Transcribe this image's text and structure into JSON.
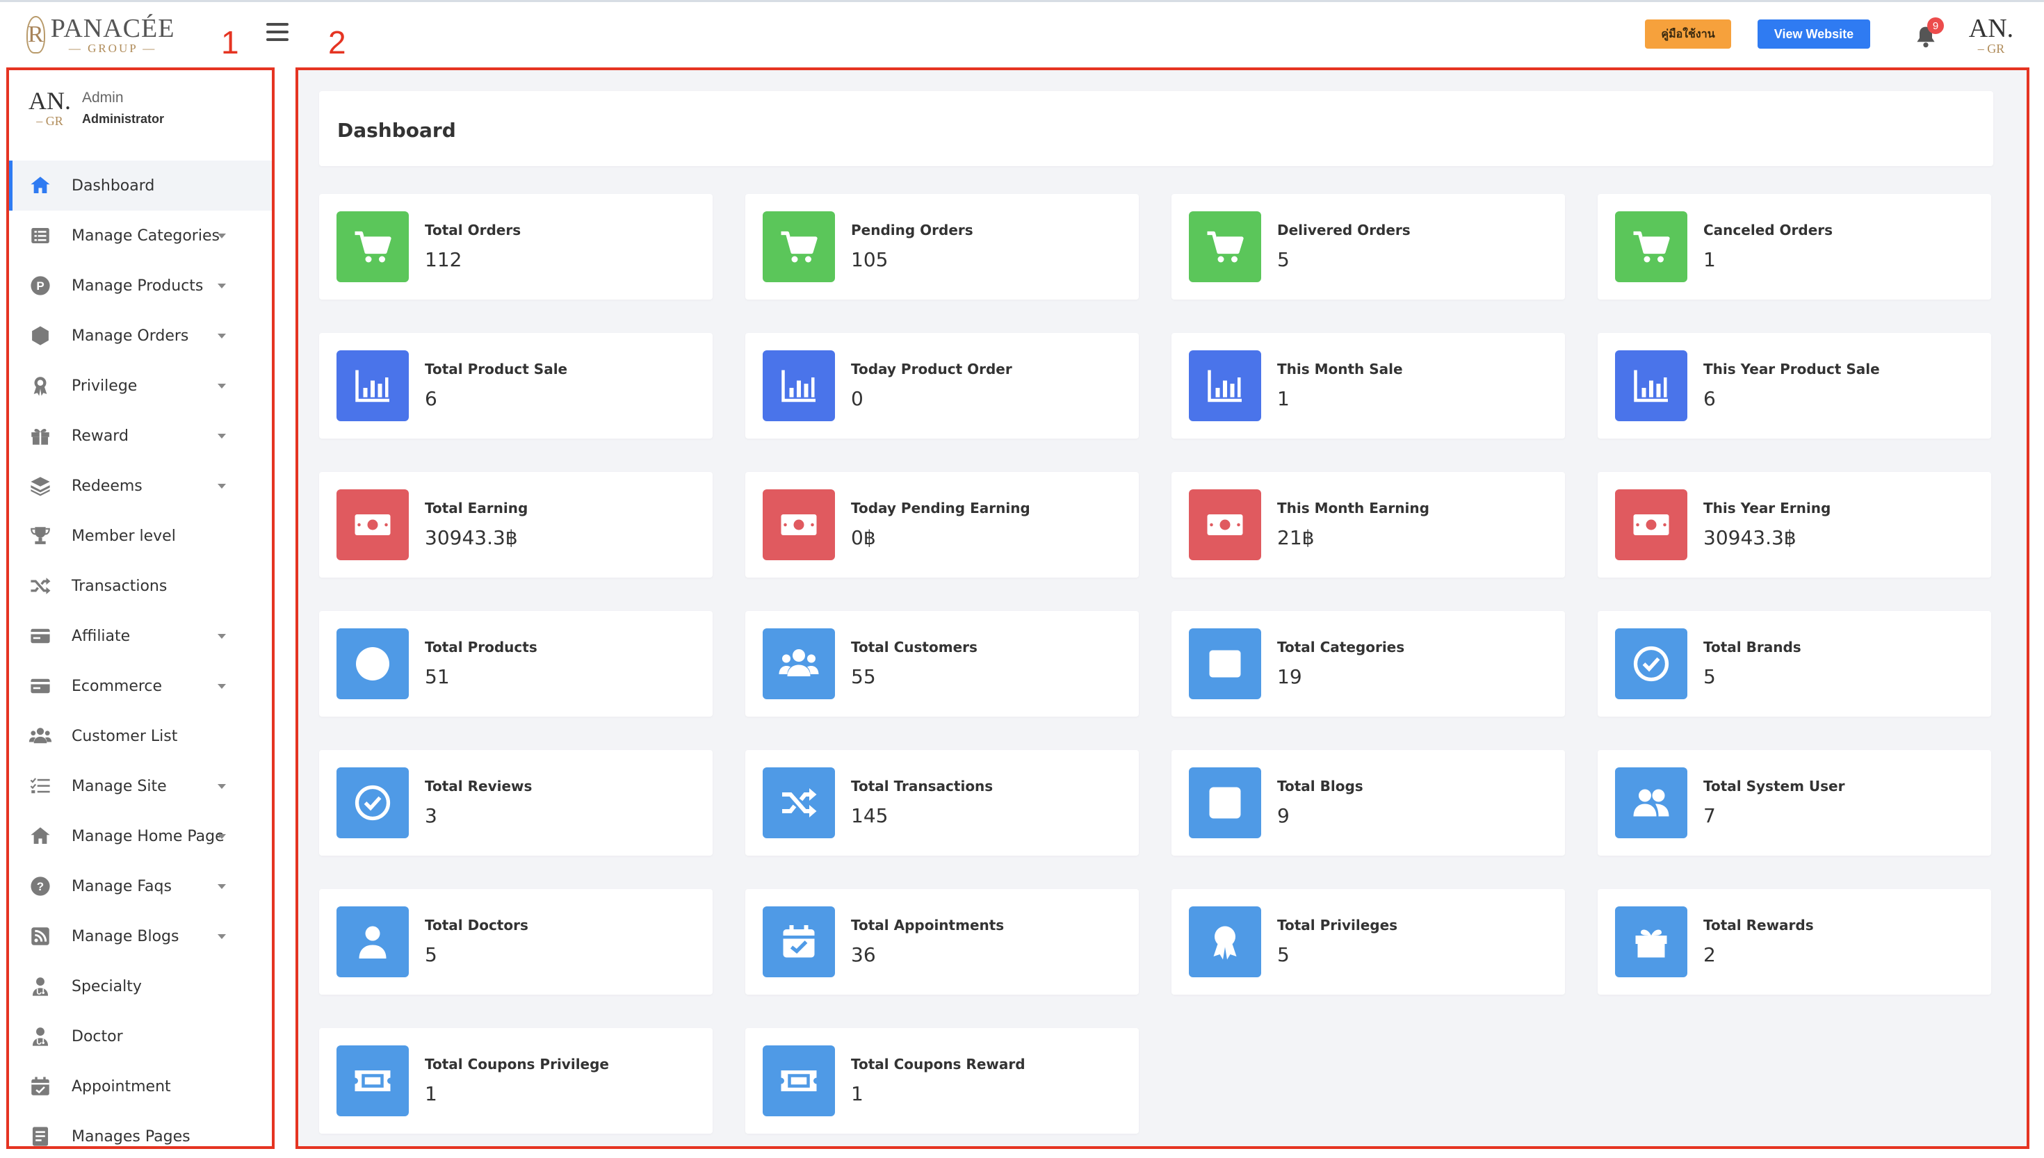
{
  "brand": {
    "mark": "R",
    "name": "PANACÉE",
    "sub": "— GROUP —"
  },
  "annotations": {
    "sidebar": "1",
    "content": "2"
  },
  "topbar": {
    "manual_button": "คู่มือใช้งาน",
    "view_website_button": "View Website",
    "notification_count": "9",
    "avatar_text": "AN.",
    "avatar_sub": "– GR"
  },
  "user": {
    "avatar_text": "AN.",
    "avatar_sub": "– GR",
    "role": "Admin",
    "name": "Administrator"
  },
  "sidebar": {
    "accent": "#2f7bf2",
    "items": [
      {
        "label": "Dashboard",
        "icon": "home-icon",
        "caret": false,
        "active": true
      },
      {
        "label": "Manage Categories",
        "icon": "list-icon",
        "caret": true
      },
      {
        "label": "Manage Products",
        "icon": "p-circle-icon",
        "caret": true
      },
      {
        "label": "Manage Orders",
        "icon": "box-icon",
        "caret": true
      },
      {
        "label": "Privilege",
        "icon": "award-icon",
        "caret": true
      },
      {
        "label": "Reward",
        "icon": "gift-icon",
        "caret": true
      },
      {
        "label": "Redeems",
        "icon": "layers-icon",
        "caret": true
      },
      {
        "label": "Member level",
        "icon": "trophy-icon",
        "caret": false
      },
      {
        "label": "Transactions",
        "icon": "shuffle-icon",
        "caret": false
      },
      {
        "label": "Affiliate",
        "icon": "card-icon",
        "caret": true
      },
      {
        "label": "Ecommerce",
        "icon": "card-icon",
        "caret": true
      },
      {
        "label": "Customer List",
        "icon": "users-icon",
        "caret": false
      },
      {
        "label": "Manage Site",
        "icon": "tasks-icon",
        "caret": true
      },
      {
        "label": "Manage Home Page",
        "icon": "home-icon",
        "caret": true
      },
      {
        "label": "Manage Faqs",
        "icon": "question-icon",
        "caret": true
      },
      {
        "label": "Manage Blogs",
        "icon": "rss-icon",
        "caret": true
      },
      {
        "label": "Specialty",
        "icon": "doctor-icon",
        "caret": false
      },
      {
        "label": "Doctor",
        "icon": "doctor-icon",
        "caret": false
      },
      {
        "label": "Appointment",
        "icon": "calendar-icon",
        "caret": false
      },
      {
        "label": "Manages Pages",
        "icon": "page-icon",
        "caret": false
      }
    ]
  },
  "dashboard": {
    "title": "Dashboard",
    "colors": {
      "green": "#5bc65a",
      "blue": "#4a74ea",
      "red": "#e05a5f",
      "sky": "#4f9ae6"
    },
    "cards": [
      {
        "label": "Total Orders",
        "value": "112",
        "color": "green",
        "icon": "cart-icon"
      },
      {
        "label": "Pending Orders",
        "value": "105",
        "color": "green",
        "icon": "cart-icon"
      },
      {
        "label": "Delivered Orders",
        "value": "5",
        "color": "green",
        "icon": "cart-icon"
      },
      {
        "label": "Canceled Orders",
        "value": "1",
        "color": "green",
        "icon": "cart-icon"
      },
      {
        "label": "Total Product Sale",
        "value": "6",
        "color": "blue",
        "icon": "bar-chart-icon"
      },
      {
        "label": "Today Product Order",
        "value": "0",
        "color": "blue",
        "icon": "bar-chart-icon"
      },
      {
        "label": "This Month Sale",
        "value": "1",
        "color": "blue",
        "icon": "bar-chart-icon"
      },
      {
        "label": "This Year Product Sale",
        "value": "6",
        "color": "blue",
        "icon": "bar-chart-icon"
      },
      {
        "label": "Total Earning",
        "value": "30943.3฿",
        "color": "red",
        "icon": "money-icon"
      },
      {
        "label": "Today Pending Earning",
        "value": "0฿",
        "color": "red",
        "icon": "money-icon"
      },
      {
        "label": "This Month Earning",
        "value": "21฿",
        "color": "red",
        "icon": "money-icon"
      },
      {
        "label": "This Year Erning",
        "value": "30943.3฿",
        "color": "red",
        "icon": "money-icon"
      },
      {
        "label": "Total Products",
        "value": "51",
        "color": "sky",
        "icon": "p-circle-icon"
      },
      {
        "label": "Total Customers",
        "value": "55",
        "color": "sky",
        "icon": "users-icon"
      },
      {
        "label": "Total Categories",
        "value": "19",
        "color": "sky",
        "icon": "list-icon"
      },
      {
        "label": "Total Brands",
        "value": "5",
        "color": "sky",
        "icon": "check-circle-icon"
      },
      {
        "label": "Total Reviews",
        "value": "3",
        "color": "sky",
        "icon": "check-circle-icon"
      },
      {
        "label": "Total Transactions",
        "value": "145",
        "color": "sky",
        "icon": "shuffle-icon"
      },
      {
        "label": "Total Blogs",
        "value": "9",
        "color": "sky",
        "icon": "rss-icon"
      },
      {
        "label": "Total System User",
        "value": "7",
        "color": "sky",
        "icon": "user-group-icon"
      },
      {
        "label": "Total Doctors",
        "value": "5",
        "color": "sky",
        "icon": "doctor-icon"
      },
      {
        "label": "Total Appointments",
        "value": "36",
        "color": "sky",
        "icon": "calendar-check-icon"
      },
      {
        "label": "Total Privileges",
        "value": "5",
        "color": "sky",
        "icon": "award-icon"
      },
      {
        "label": "Total Rewards",
        "value": "2",
        "color": "sky",
        "icon": "gift-icon"
      },
      {
        "label": "Total Coupons Privilege",
        "value": "1",
        "color": "sky",
        "icon": "ticket-icon"
      },
      {
        "label": "Total Coupons Reward",
        "value": "1",
        "color": "sky",
        "icon": "ticket-icon"
      }
    ]
  }
}
